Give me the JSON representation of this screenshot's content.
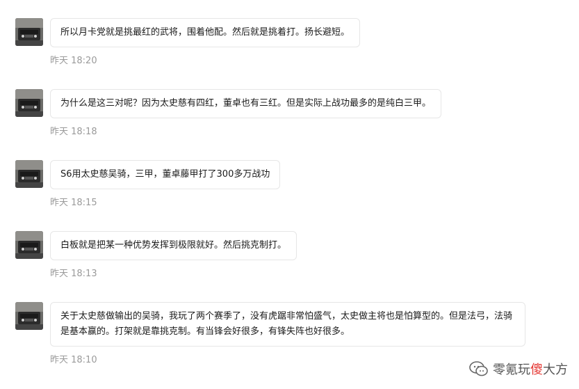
{
  "messages": [
    {
      "text": "所以月卡党就是挑最红的武将，围着他配。然后就是挑着打。扬长避短。",
      "time": "昨天 18:20"
    },
    {
      "text": "为什么是这三对呢？因为太史慈有四红，董卓也有三红。但是实际上战功最多的是纯白三甲。",
      "time": "昨天 18:18"
    },
    {
      "text": "S6用太史慈吴骑，三甲，董卓藤甲打了300多万战功",
      "time": "昨天 18:15"
    },
    {
      "text": "白板就是把某一种优势发挥到极限就好。然后挑克制打。",
      "time": "昨天 18:13"
    },
    {
      "text": "关于太史慈做输出的吴骑，我玩了两个赛季了，没有虎踞非常怕盛气，太史做主将也是怕算型的。但是法弓，法骑是基本赢的。打架就是靠挑克制。有当锋会好很多，有锋失阵也好很多。",
      "time": "昨天 18:10"
    }
  ],
  "watermark": {
    "part1": "零氪玩",
    "part2": "傻",
    "part3": "大方"
  }
}
